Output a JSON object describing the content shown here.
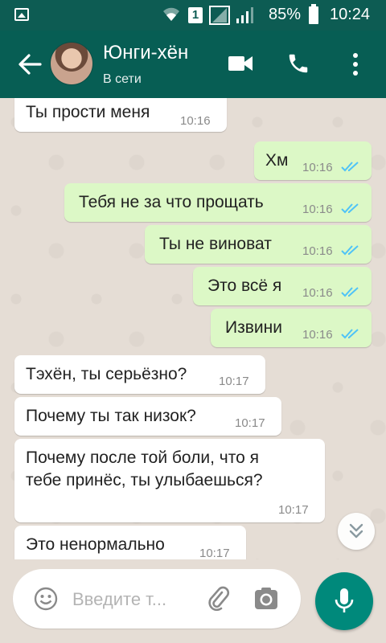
{
  "status_bar": {
    "battery": "85%",
    "time": "10:24",
    "sim_slot": "1",
    "icons": [
      "image-icon",
      "wifi-icon",
      "sim-icon",
      "signal-icon",
      "signal-icon",
      "battery-icon"
    ]
  },
  "header": {
    "name": "Юнги-хён",
    "status": "В сети",
    "icons": [
      "back-arrow-icon",
      "avatar",
      "video-call-icon",
      "phone-icon",
      "more-vert-icon"
    ],
    "color": "#075e54"
  },
  "messages": [
    {
      "dir": "in",
      "text": "Ты прости меня",
      "time": "10:16"
    },
    {
      "dir": "out",
      "text": "Хм",
      "time": "10:16",
      "read": true
    },
    {
      "dir": "out",
      "text": "Тебя не за что прощать",
      "time": "10:16",
      "read": true
    },
    {
      "dir": "out",
      "text": "Ты не виноват",
      "time": "10:16",
      "read": true
    },
    {
      "dir": "out",
      "text": "Это всё я",
      "time": "10:16",
      "read": true
    },
    {
      "dir": "out",
      "text": "Извини",
      "time": "10:16",
      "read": true
    },
    {
      "dir": "in",
      "text": "Тэхён, ты серьёзно?",
      "time": "10:17"
    },
    {
      "dir": "in",
      "text": "Почему ты так низок?",
      "time": "10:17"
    },
    {
      "dir": "in",
      "text_line1": "Почему после той боли, что я",
      "text_line2": "тебе принёс, ты улыбаешься?",
      "time": "10:17"
    },
    {
      "dir": "in",
      "text": "Это ненормально",
      "time": "10:17"
    }
  ],
  "composer": {
    "placeholder": "Введите т...",
    "icons": [
      "emoji-icon",
      "attach-icon",
      "camera-icon",
      "mic-icon"
    ]
  },
  "colors": {
    "outgoing_bubble": "#dcf8c6",
    "incoming_bubble": "#ffffff",
    "read_ticks": "#4fc3f7",
    "mic_button": "#00897b"
  }
}
